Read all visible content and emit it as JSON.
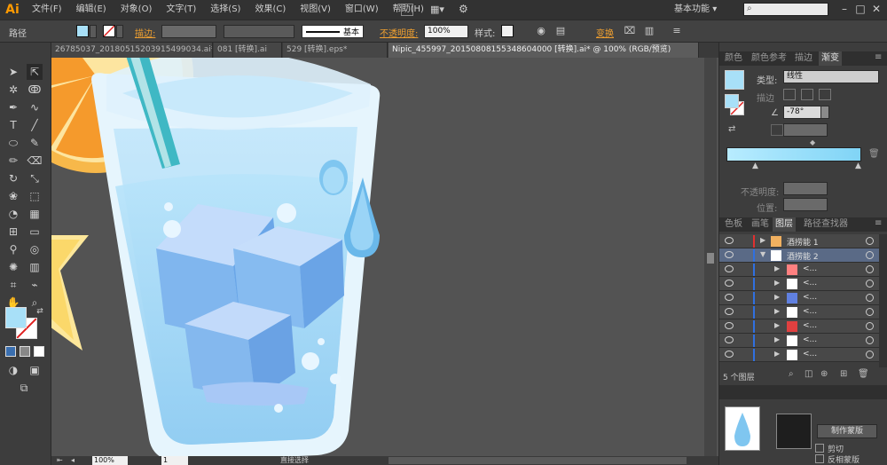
{
  "app": {
    "logo": "Ai"
  },
  "menu": [
    "文件(F)",
    "编辑(E)",
    "对象(O)",
    "文字(T)",
    "选择(S)",
    "效果(C)",
    "视图(V)",
    "窗口(W)",
    "帮助(H)"
  ],
  "workspace": {
    "label": "基本功能",
    "chevron": "▾"
  },
  "control_bar": {
    "selection_type": "路径",
    "stroke_label": "描边:",
    "stroke_style": "基本",
    "opacity_label": "不透明度:",
    "opacity_value": "100%",
    "style_label": "样式:",
    "transform_label": "变换",
    "fill_color": "#a8e0f8"
  },
  "tabs": [
    {
      "label": "26785037_20180515203915499034.ai*",
      "active": false
    },
    {
      "label": "081 [转换].ai",
      "active": false
    },
    {
      "label": "529 [转换].eps*",
      "active": false
    },
    {
      "label": "Nipic_455997_20150808155348604000 [转换].ai* @ 100% (RGB/预览)",
      "active": true
    }
  ],
  "status": {
    "zoom": "100%",
    "page": "1",
    "mode": "直接选择"
  },
  "gradient_panel": {
    "tabs": [
      "颜色",
      "颜色参考",
      "描边",
      "渐变"
    ],
    "type_label": "类型:",
    "type_value": "线性",
    "stroke_label": "描边",
    "angle": "-78°",
    "opacity_label": "不透明度:",
    "position_label": "位置:",
    "start_color": "#b8ecff",
    "end_color": "#80d4f6"
  },
  "layers_panel": {
    "tabs": [
      "色板",
      "画笔",
      "图层",
      "路径查找器"
    ],
    "layers": [
      {
        "name": "酒捞能 1",
        "level": 0,
        "expanded": false,
        "color": "#e03030",
        "selected": false
      },
      {
        "name": "酒捞能 2",
        "level": 0,
        "expanded": true,
        "color": "#3070e0",
        "selected": true
      },
      {
        "name": "<...",
        "level": 1,
        "expanded": false,
        "color": "#3070e0",
        "selected": false
      },
      {
        "name": "<...",
        "level": 1,
        "expanded": false,
        "color": "#3070e0",
        "selected": false
      },
      {
        "name": "<...",
        "level": 1,
        "expanded": false,
        "color": "#3070e0",
        "selected": false
      },
      {
        "name": "<...",
        "level": 1,
        "expanded": false,
        "color": "#3070e0",
        "selected": false
      },
      {
        "name": "<...",
        "level": 1,
        "expanded": false,
        "color": "#3070e0",
        "selected": false
      },
      {
        "name": "<...",
        "level": 1,
        "expanded": false,
        "color": "#3070e0",
        "selected": false
      },
      {
        "name": "<...",
        "level": 1,
        "expanded": false,
        "color": "#3070e0",
        "selected": false
      }
    ],
    "count_label": "5 个图层"
  },
  "transparency_panel": {
    "make_mask": "制作蒙版",
    "clip": "剪切",
    "invert_mask": "反相蒙版"
  }
}
